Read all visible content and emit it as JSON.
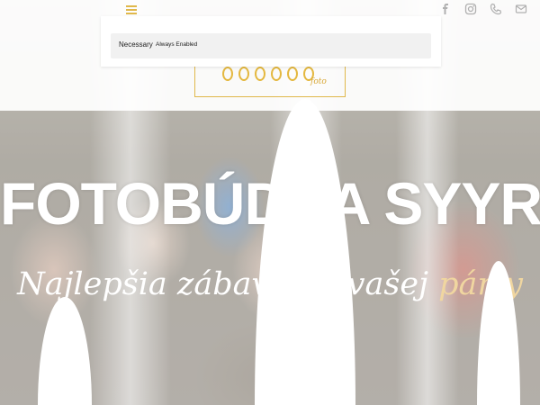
{
  "cookie_banner": {
    "category_name": "Necessary",
    "status": "Always Enabled"
  },
  "hero": {
    "title": "FOTOBÚDKA SYYR",
    "subtitle_main": "Najlepšia zábava na vašej ",
    "subtitle_accent": "párty"
  },
  "colors": {
    "accent": "#e0b84b",
    "subtitle_accent": "#f0d6a0"
  },
  "icons": {
    "menu": "hamburger-menu-icon",
    "social": [
      "facebook-icon",
      "instagram-icon",
      "phone-icon",
      "email-icon"
    ]
  }
}
